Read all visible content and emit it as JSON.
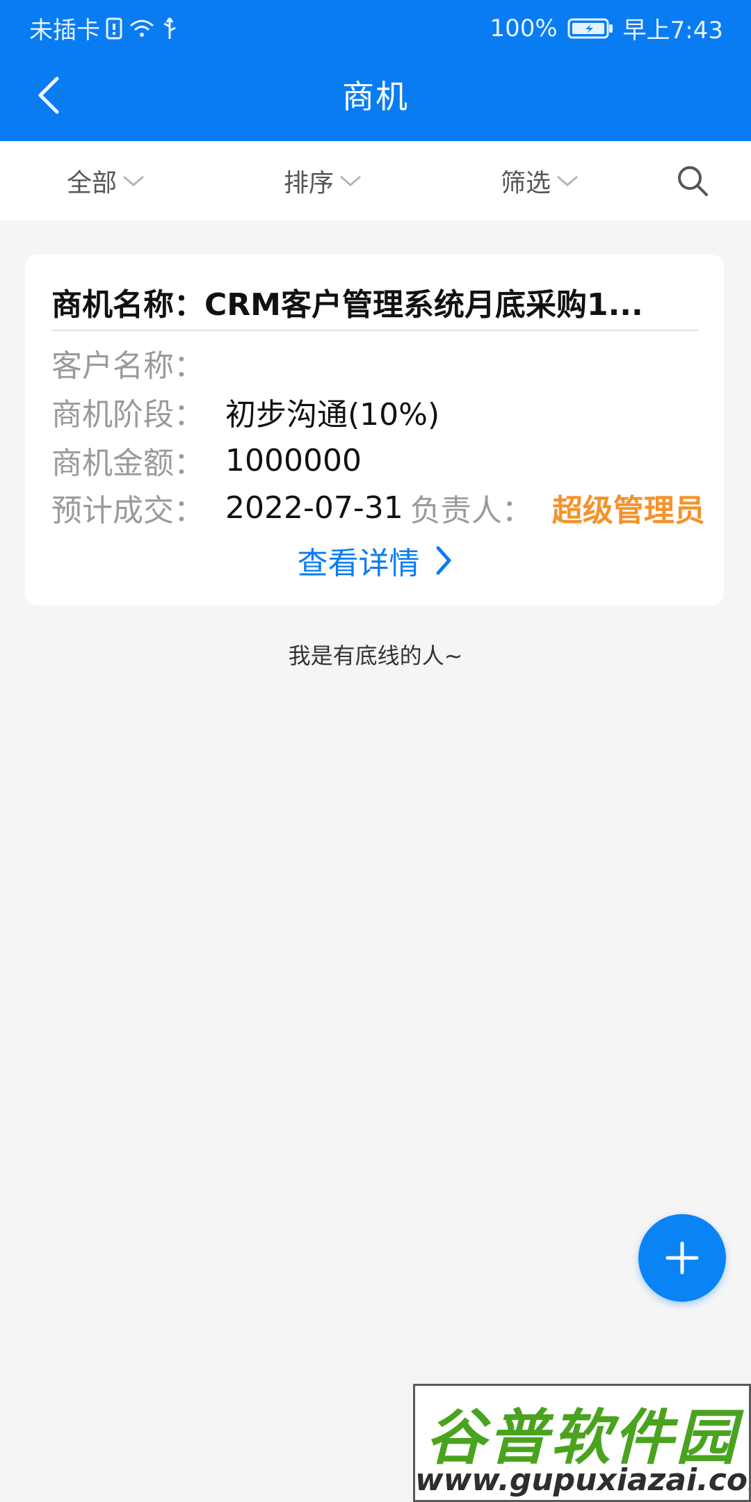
{
  "status_bar": {
    "carrier": "未插卡",
    "battery": "100%",
    "time": "早上7:43"
  },
  "nav": {
    "title": "商机"
  },
  "filters": {
    "all": "全部",
    "sort": "排序",
    "filter": "筛选"
  },
  "card": {
    "title_label": "商机名称：",
    "title_value": "CRM客户管理系统月底采购1...",
    "customer_label": "客户名称：",
    "customer_value": "",
    "stage_label": "商机阶段：",
    "stage_value": "初步沟通(10%)",
    "amount_label": "商机金额：",
    "amount_value": "1000000",
    "deal_label": "预计成交：",
    "deal_value": "2022-07-31",
    "owner_label": "负责人：",
    "owner_value": "超级管理员",
    "detail_link": "查看详情"
  },
  "bottom_text": "我是有底线的人~",
  "watermark": {
    "title": "谷普软件园",
    "url": "www.gupuxiazai.com"
  },
  "colors": {
    "primary": "#0a7cf2",
    "accent": "#f5922a",
    "background": "#f5f5f5"
  },
  "icons": [
    "back-icon",
    "chevron-down-icon",
    "search-icon",
    "chevron-right-icon",
    "plus-icon",
    "wifi-icon",
    "usb-icon",
    "battery-icon"
  ]
}
